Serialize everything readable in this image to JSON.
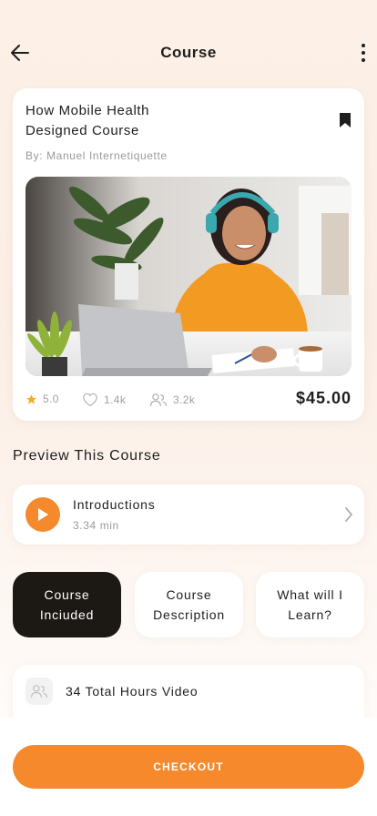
{
  "header": {
    "title": "Course",
    "back_icon": "arrow-left-icon",
    "more_icon": "more-vertical-icon"
  },
  "course": {
    "title_line1": "How Mobile Health",
    "title_line2": "Designed Course",
    "author": "By: Manuel Internetiquette",
    "bookmark_icon": "bookmark-icon",
    "rating": "5.0",
    "likes": "1.4k",
    "students": "3.2k",
    "price": "$45.00"
  },
  "preview": {
    "heading": "Preview This Course",
    "lesson_title": "Introductions",
    "lesson_duration": "3.34 min"
  },
  "tabs": [
    {
      "line1": "Course",
      "line2": "Inciuded",
      "active": true
    },
    {
      "line1": "Course",
      "line2": "Description",
      "active": false
    },
    {
      "line1": "What will I",
      "line2": "Learn?",
      "active": false
    }
  ],
  "info": {
    "text": "34 Total Hours Video",
    "icon": "users-icon"
  },
  "checkout": {
    "label": "CHECKOUT"
  },
  "colors": {
    "accent": "#f5892b",
    "dark": "#1c1915",
    "star": "#f5b01b"
  }
}
